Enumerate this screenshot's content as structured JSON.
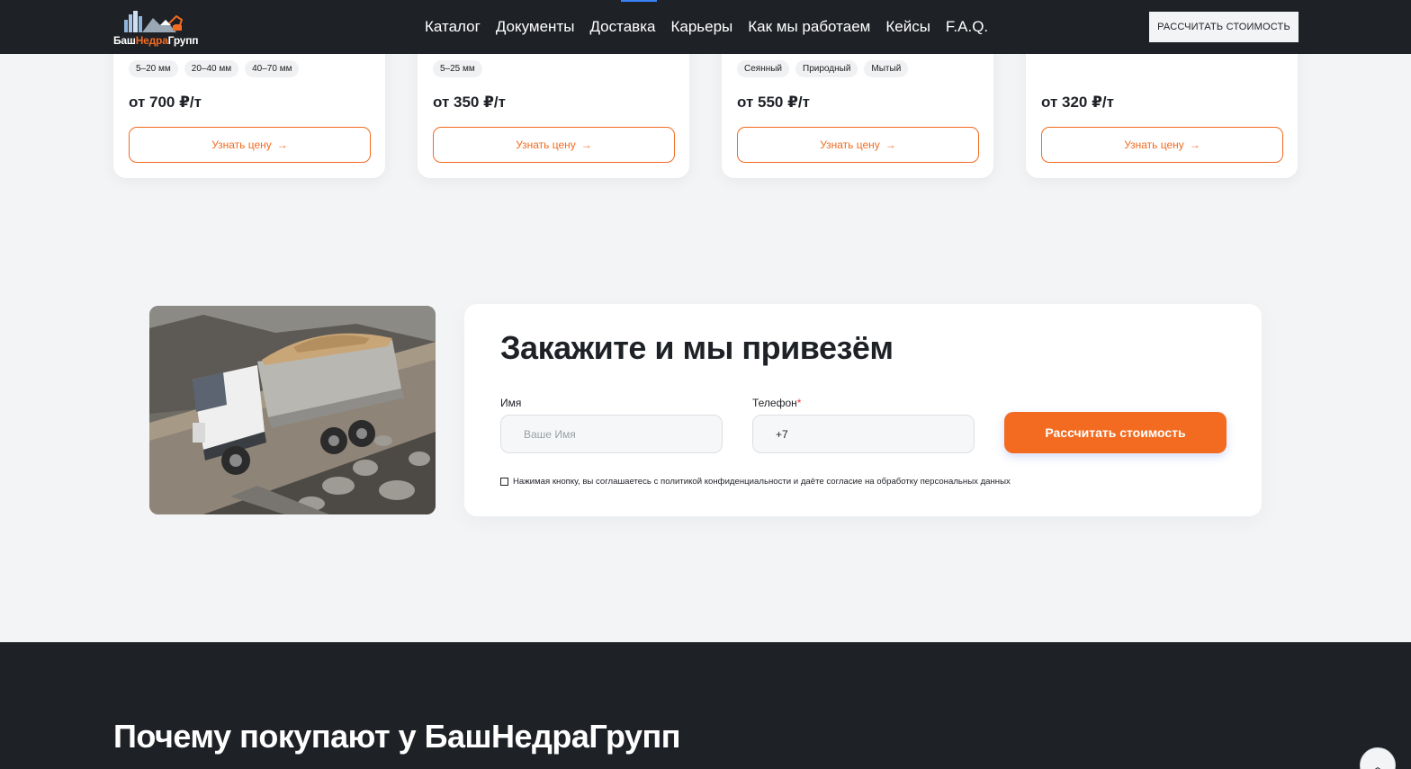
{
  "header": {
    "logo": {
      "part1": "Баш",
      "part2": "Недра",
      "part3": "Групп"
    },
    "nav": [
      "Каталог",
      "Документы",
      "Доставка",
      "Карьеры",
      "Как мы работаем",
      "Кейсы",
      "F.A.Q."
    ],
    "cta_label": "РАССЧИТАТЬ СТОИМОСТЬ"
  },
  "products": [
    {
      "chips": [
        "5–20 мм",
        "20–40 мм",
        "40–70 мм"
      ],
      "price": "от 700 ₽/т",
      "button": "Узнать цену"
    },
    {
      "chips": [
        "5–25 мм"
      ],
      "price": "от 350 ₽/т",
      "button": "Узнать цену"
    },
    {
      "chips": [
        "Сеянный",
        "Природный",
        "Мытый"
      ],
      "price": "от 550 ₽/т",
      "button": "Узнать цену"
    },
    {
      "chips": [],
      "price": "от 320 ₽/т",
      "button": "Узнать цену"
    }
  ],
  "order": {
    "title": "Закажите и мы привезём",
    "name_label": "Имя",
    "name_placeholder": "Ваше Имя",
    "phone_label": "Телефон",
    "phone_required": "*",
    "phone_value": "+7",
    "submit_label": "Рассчитать стоимость",
    "consent": "Нажимая кнопку, вы соглашаетесь с политикой конфиденциальности и даёте согласие на обработку персональных данных"
  },
  "why": {
    "title": "Почему покупают у БашНедраГрупп"
  },
  "colors": {
    "accent": "#f26b21",
    "dark": "#1e2126",
    "background": "#f3f4f6"
  },
  "icons": {
    "card_button": "arrow-right-icon",
    "scroll_top": "chevron-up-icon"
  }
}
